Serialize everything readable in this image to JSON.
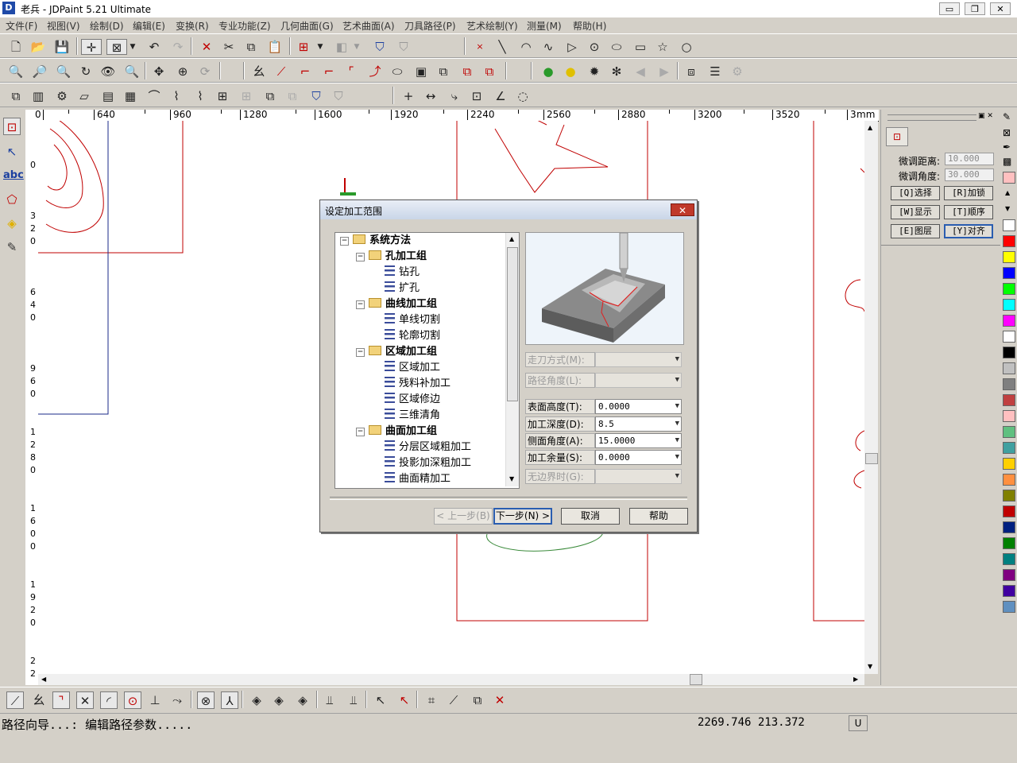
{
  "window": {
    "app_icon": "D",
    "title": "老兵 - JDPaint 5.21 Ultimate",
    "minimize": "▭",
    "restore": "❐",
    "close": "✕"
  },
  "menu": [
    "文件(F)",
    "视图(V)",
    "绘制(D)",
    "编辑(E)",
    "变换(R)",
    "专业功能(Z)",
    "几何曲面(G)",
    "艺术曲面(A)",
    "刀具路径(P)",
    "艺术绘制(Y)",
    "测量(M)",
    "帮助(H)"
  ],
  "ruler_top": {
    "labels": [
      "640",
      "960",
      "1280",
      "1600",
      "1920",
      "2240",
      "2560",
      "2880",
      "3200",
      "3520",
      "3"
    ],
    "unit": "mm",
    "leading": "0"
  },
  "ruler_left": {
    "groups": [
      [
        "0"
      ],
      [
        "3",
        "2",
        "0"
      ],
      [
        "6",
        "4",
        "0"
      ],
      [
        "9",
        "6",
        "0"
      ],
      [
        "1",
        "2",
        "8",
        "0"
      ],
      [
        "1",
        "6",
        "0",
        "0"
      ],
      [
        "1",
        "9",
        "2",
        "0"
      ],
      [
        "2",
        "2"
      ]
    ]
  },
  "right_panel": {
    "distance_label": "微调距离:",
    "distance_value": "10.000",
    "angle_label": "微调角度:",
    "angle_value": "30.000",
    "buttons": [
      "[Q]选择",
      "[R]加锁",
      "[W]显示",
      "[T]顺序",
      "[E]图层",
      "[Y]对齐"
    ]
  },
  "palette": {
    "colors": [
      "#ffc0c0",
      "#ffffff",
      "#ff0000",
      "#ffff00",
      "#0000ff",
      "#00ff00",
      "#00ffff",
      "#ff00ff",
      "#ffffff",
      "#000000",
      "#c0c0c0",
      "#808080",
      "#c04040",
      "#ffc0c0",
      "#60c080",
      "#40a0a0",
      "#ffd000",
      "#ff9040",
      "#808000",
      "#c00000",
      "#002080",
      "#008000",
      "#008080",
      "#800080",
      "#4000a0",
      "#6090c0",
      "#909090"
    ]
  },
  "dialog": {
    "title": "设定加工范围",
    "close": "✕",
    "tree": [
      {
        "type": "root",
        "label": "系统方法"
      },
      {
        "type": "group",
        "label": "孔加工组"
      },
      {
        "type": "leaf",
        "label": "钻孔"
      },
      {
        "type": "leaf",
        "label": "扩孔"
      },
      {
        "type": "group",
        "label": "曲线加工组"
      },
      {
        "type": "leaf",
        "label": "单线切割"
      },
      {
        "type": "leaf",
        "label": "轮廓切割"
      },
      {
        "type": "group",
        "label": "区域加工组"
      },
      {
        "type": "leaf",
        "label": "区域加工"
      },
      {
        "type": "leaf",
        "label": "残料补加工"
      },
      {
        "type": "leaf",
        "label": "区域修边"
      },
      {
        "type": "leaf",
        "label": "三维清角"
      },
      {
        "type": "group",
        "label": "曲面加工组"
      },
      {
        "type": "leaf",
        "label": "分层区域粗加工"
      },
      {
        "type": "leaf",
        "label": "投影加深粗加工"
      },
      {
        "type": "leaf",
        "label": "曲面精加工"
      }
    ],
    "fields": [
      {
        "label": "走刀方式(M):",
        "value": "",
        "disabled": true
      },
      {
        "label": "路径角度(L):",
        "value": "",
        "disabled": true
      },
      {
        "label": "表面高度(T):",
        "value": "0.0000",
        "disabled": false
      },
      {
        "label": "加工深度(D):",
        "value": "8.5",
        "disabled": false
      },
      {
        "label": "侧面角度(A):",
        "value": "15.0000",
        "disabled": false
      },
      {
        "label": "加工余量(S):",
        "value": "0.0000",
        "disabled": false
      },
      {
        "label": "无边界时(G):",
        "value": "",
        "disabled": true
      }
    ],
    "buttons": {
      "prev": "< 上一步(B)",
      "next": "下一步(N) >",
      "cancel": "取消",
      "help": "帮助"
    }
  },
  "status": {
    "text": "路径向导...: 编辑路径参数.....",
    "coords": "2269.746 213.372",
    "unit": "U"
  },
  "colors": {
    "drawing_line": "#c00000",
    "path_line": "#3a8a3a",
    "dialog_accent": "#2a5db0"
  }
}
